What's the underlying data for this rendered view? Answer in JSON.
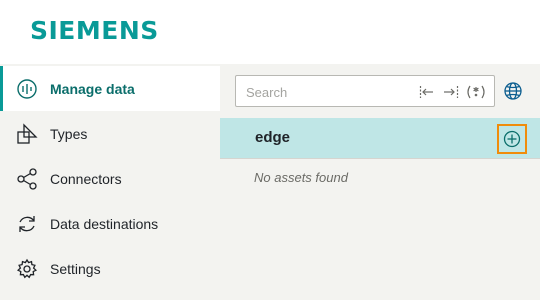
{
  "brand": {
    "logo_text": "SIEMENS",
    "color": "#099a97"
  },
  "sidebar": {
    "items": [
      {
        "label": "Manage data",
        "icon": "manage-data-icon",
        "active": true
      },
      {
        "label": "Types",
        "icon": "types-icon",
        "active": false
      },
      {
        "label": "Connectors",
        "icon": "connectors-icon",
        "active": false
      },
      {
        "label": "Data destinations",
        "icon": "data-destinations-icon",
        "active": false
      },
      {
        "label": "Settings",
        "icon": "gear-icon",
        "active": false
      }
    ]
  },
  "search": {
    "placeholder": "Search",
    "value": "",
    "options": [
      "match-word-icon",
      "match-case-icon",
      "regex-icon"
    ]
  },
  "assets": {
    "rows": [
      {
        "name": "edge",
        "action": "add-icon"
      }
    ],
    "empty_message": "No assets found"
  },
  "colors": {
    "accent": "#099a97",
    "selected_row": "#bfe6e6",
    "focus_outline": "#f08c0a"
  }
}
